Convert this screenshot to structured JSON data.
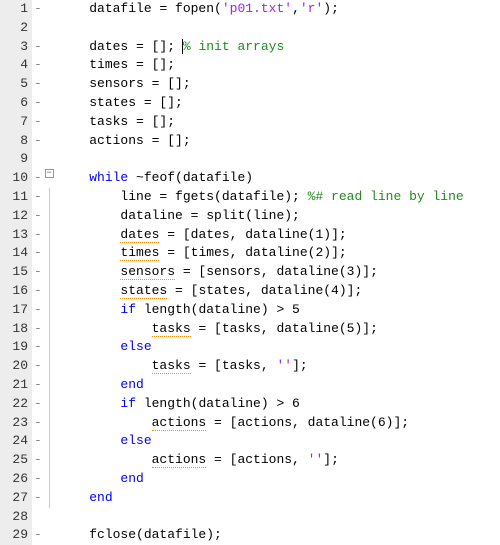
{
  "lines": [
    {
      "num": "1",
      "dash": "-",
      "fold": "",
      "indent": "    ",
      "tokens": [
        [
          "",
          "datafile = fopen("
        ],
        [
          "str",
          "'p01.txt'"
        ],
        [
          "",
          ","
        ],
        [
          "str",
          "'r'"
        ],
        [
          "",
          ");"
        ]
      ]
    },
    {
      "num": "2",
      "dash": "",
      "fold": "",
      "indent": "",
      "tokens": []
    },
    {
      "num": "3",
      "dash": "-",
      "fold": "",
      "indent": "    ",
      "tokens": [
        [
          "",
          "dates = []; "
        ],
        [
          "cursor",
          ""
        ],
        [
          "cmt",
          "% init arrays"
        ]
      ]
    },
    {
      "num": "4",
      "dash": "-",
      "fold": "",
      "indent": "    ",
      "tokens": [
        [
          "",
          "times = [];"
        ]
      ]
    },
    {
      "num": "5",
      "dash": "-",
      "fold": "",
      "indent": "    ",
      "tokens": [
        [
          "",
          "sensors = [];"
        ]
      ]
    },
    {
      "num": "6",
      "dash": "-",
      "fold": "",
      "indent": "    ",
      "tokens": [
        [
          "",
          "states = [];"
        ]
      ]
    },
    {
      "num": "7",
      "dash": "-",
      "fold": "",
      "indent": "    ",
      "tokens": [
        [
          "",
          "tasks = [];"
        ]
      ]
    },
    {
      "num": "8",
      "dash": "-",
      "fold": "",
      "indent": "    ",
      "tokens": [
        [
          "",
          "actions = [];"
        ]
      ]
    },
    {
      "num": "9",
      "dash": "",
      "fold": "",
      "indent": "",
      "tokens": []
    },
    {
      "num": "10",
      "dash": "-",
      "fold": "box",
      "indent": "    ",
      "tokens": [
        [
          "kw",
          "while"
        ],
        [
          "",
          " ~feof(datafile)"
        ]
      ]
    },
    {
      "num": "11",
      "dash": "-",
      "fold": "line",
      "indent": "        ",
      "tokens": [
        [
          "",
          "line = fgets(datafile); "
        ],
        [
          "cmt",
          "%# read line by line"
        ]
      ]
    },
    {
      "num": "12",
      "dash": "-",
      "fold": "line",
      "indent": "        ",
      "tokens": [
        [
          "",
          "dataline = split(line);"
        ]
      ]
    },
    {
      "num": "13",
      "dash": "-",
      "fold": "line",
      "indent": "        ",
      "tokens": [
        [
          "warn",
          "dates"
        ],
        [
          "",
          " = [dates, dataline(1)];"
        ]
      ]
    },
    {
      "num": "14",
      "dash": "-",
      "fold": "line",
      "indent": "        ",
      "tokens": [
        [
          "warn",
          "times"
        ],
        [
          "",
          " = [times, dataline(2)];"
        ]
      ]
    },
    {
      "num": "15",
      "dash": "-",
      "fold": "line",
      "indent": "        ",
      "tokens": [
        [
          "warn",
          "sensors"
        ],
        [
          "",
          " = [sensors, dataline(3)];"
        ]
      ]
    },
    {
      "num": "16",
      "dash": "-",
      "fold": "line",
      "indent": "        ",
      "tokens": [
        [
          "warn",
          "states"
        ],
        [
          "",
          " = [states, dataline(4)];"
        ]
      ]
    },
    {
      "num": "17",
      "dash": "-",
      "fold": "line",
      "indent": "        ",
      "tokens": [
        [
          "kw",
          "if"
        ],
        [
          "",
          " length(dataline) > 5"
        ]
      ]
    },
    {
      "num": "18",
      "dash": "-",
      "fold": "line",
      "indent": "            ",
      "tokens": [
        [
          "warn",
          "tasks"
        ],
        [
          "",
          " = [tasks, dataline(5)];"
        ]
      ]
    },
    {
      "num": "19",
      "dash": "-",
      "fold": "line",
      "indent": "        ",
      "tokens": [
        [
          "kw",
          "else"
        ]
      ]
    },
    {
      "num": "20",
      "dash": "-",
      "fold": "line",
      "indent": "            ",
      "tokens": [
        [
          "warn",
          "tasks"
        ],
        [
          "",
          " = [tasks, "
        ],
        [
          "str",
          "''"
        ],
        [
          "",
          "];"
        ]
      ]
    },
    {
      "num": "21",
      "dash": "-",
      "fold": "line",
      "indent": "        ",
      "tokens": [
        [
          "kw",
          "end"
        ]
      ]
    },
    {
      "num": "22",
      "dash": "-",
      "fold": "line",
      "indent": "        ",
      "tokens": [
        [
          "kw",
          "if"
        ],
        [
          "",
          " length(dataline) > 6"
        ]
      ]
    },
    {
      "num": "23",
      "dash": "-",
      "fold": "line",
      "indent": "            ",
      "tokens": [
        [
          "warn",
          "actions"
        ],
        [
          "",
          " = [actions, dataline(6)];"
        ]
      ]
    },
    {
      "num": "24",
      "dash": "-",
      "fold": "line",
      "indent": "        ",
      "tokens": [
        [
          "kw",
          "else"
        ]
      ]
    },
    {
      "num": "25",
      "dash": "-",
      "fold": "line",
      "indent": "            ",
      "tokens": [
        [
          "warn",
          "actions"
        ],
        [
          "",
          " = [actions, "
        ],
        [
          "str",
          "''"
        ],
        [
          "",
          "];"
        ]
      ]
    },
    {
      "num": "26",
      "dash": "-",
      "fold": "line",
      "indent": "        ",
      "tokens": [
        [
          "kw",
          "end"
        ]
      ]
    },
    {
      "num": "27",
      "dash": "-",
      "fold": "line",
      "indent": "    ",
      "tokens": [
        [
          "kw",
          "end"
        ]
      ]
    },
    {
      "num": "28",
      "dash": "",
      "fold": "",
      "indent": "",
      "tokens": []
    },
    {
      "num": "29",
      "dash": "-",
      "fold": "",
      "indent": "    ",
      "tokens": [
        [
          "",
          "fclose(datafile);"
        ]
      ]
    }
  ]
}
